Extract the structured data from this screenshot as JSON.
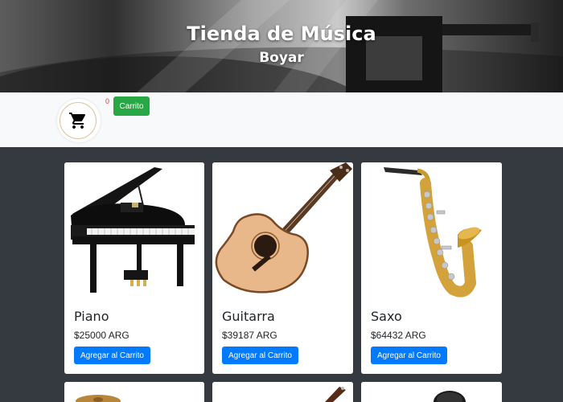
{
  "header": {
    "title": "Tienda de Música",
    "subtitle": "Boyar"
  },
  "cart": {
    "count": "0",
    "button_label": "Carrito",
    "icon": "shopping-cart-icon"
  },
  "products": [
    {
      "name": "Piano",
      "price": "$25000 ARG",
      "button_label": "Agregar al Carrito",
      "icon": "piano-image"
    },
    {
      "name": "Guitarra",
      "price": "$39187 ARG",
      "button_label": "Agregar al Carrito",
      "icon": "guitar-image"
    },
    {
      "name": "Saxo",
      "price": "$64432 ARG",
      "button_label": "Agregar al Carrito",
      "icon": "saxophone-image"
    }
  ],
  "colors": {
    "cart_button": "#28a745",
    "add_button": "#007bff",
    "page_background": "#343a40",
    "cart_count": "#dc3545"
  }
}
